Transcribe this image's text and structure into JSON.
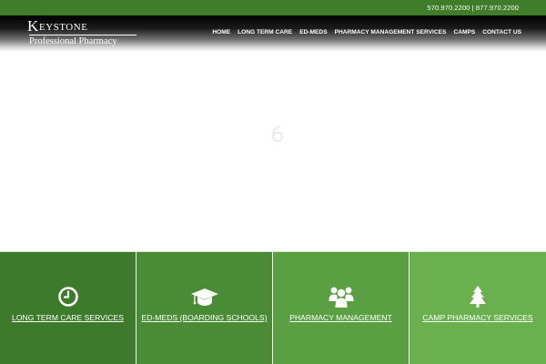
{
  "topbar": {
    "phones": "570.970.2200 | 877.970.2200"
  },
  "logo": {
    "initial": "K",
    "rest": "EYSTONE",
    "subtitle": "Professional Pharmacy"
  },
  "nav": {
    "items": [
      {
        "label": "HOME"
      },
      {
        "label": "LONG TERM CARE"
      },
      {
        "label": "ED-MEDS"
      },
      {
        "label": "PHARMACY MANAGEMENT SERVICES"
      },
      {
        "label": "CAMPS"
      },
      {
        "label": "CONTACT US"
      }
    ]
  },
  "tiles": [
    {
      "label": "LONG TERM CARE SERVICES",
      "icon": "clock-icon",
      "color": "#3d7a2c"
    },
    {
      "label": "ED-MEDS (BOARDING SCHOOLS)",
      "icon": "graduation-cap-icon",
      "color": "#4a8b35"
    },
    {
      "label": "PHARMACY MANAGEMENT",
      "icon": "group-icon",
      "color": "#5aa043"
    },
    {
      "label": "CAMP PHARMACY SERVICES",
      "icon": "pine-tree-icon",
      "color": "#6ab04e"
    }
  ]
}
